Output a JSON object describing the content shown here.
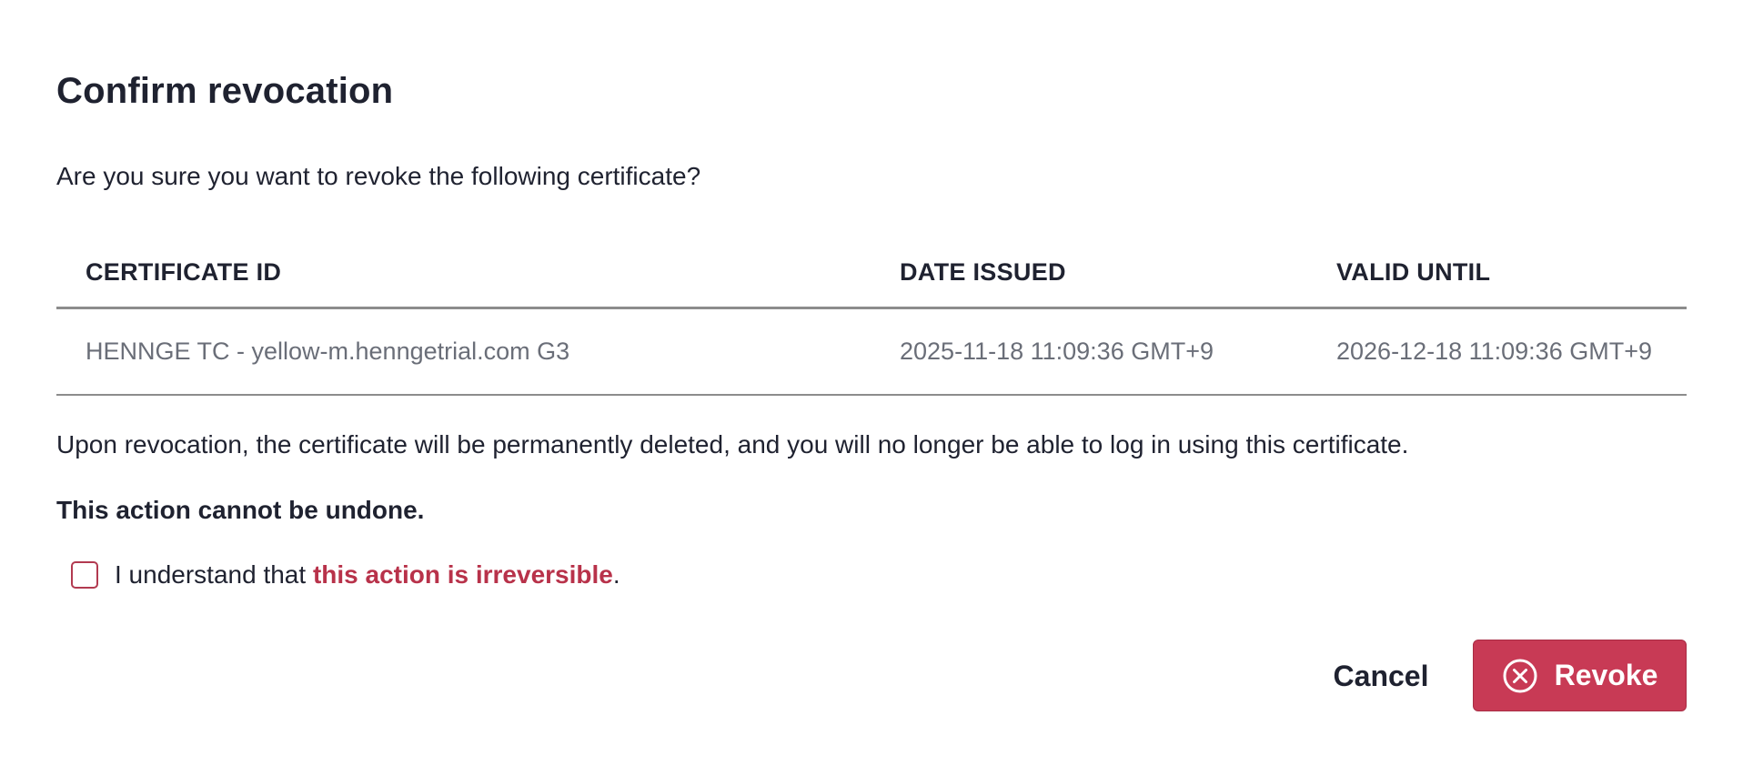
{
  "dialog": {
    "title": "Confirm revocation",
    "question": "Are you sure you want to revoke the following certificate?",
    "table": {
      "headers": [
        "CERTIFICATE ID",
        "DATE ISSUED",
        "VALID UNTIL"
      ],
      "rows": [
        [
          "HENNGE TC - yellow-m.henngetrial.com G3",
          "2025-11-18 11:09:36 GMT+9",
          "2026-12-18 11:09:36 GMT+9"
        ]
      ]
    },
    "info": "Upon revocation, the certificate will be permanently deleted, and you will no longer be able to log in using this certificate.",
    "warning": "This action cannot be undone.",
    "confirm": {
      "prefix": "I understand that ",
      "emphasis": "this action is irreversible",
      "suffix": ".",
      "checked": false
    },
    "buttons": {
      "cancel": "Cancel",
      "revoke": "Revoke",
      "revoke_icon": "close-circle-icon"
    },
    "colors": {
      "danger": "#c83a55",
      "emphasis": "#b8324a",
      "text": "#1f2230",
      "muted": "#6a6e78"
    }
  }
}
